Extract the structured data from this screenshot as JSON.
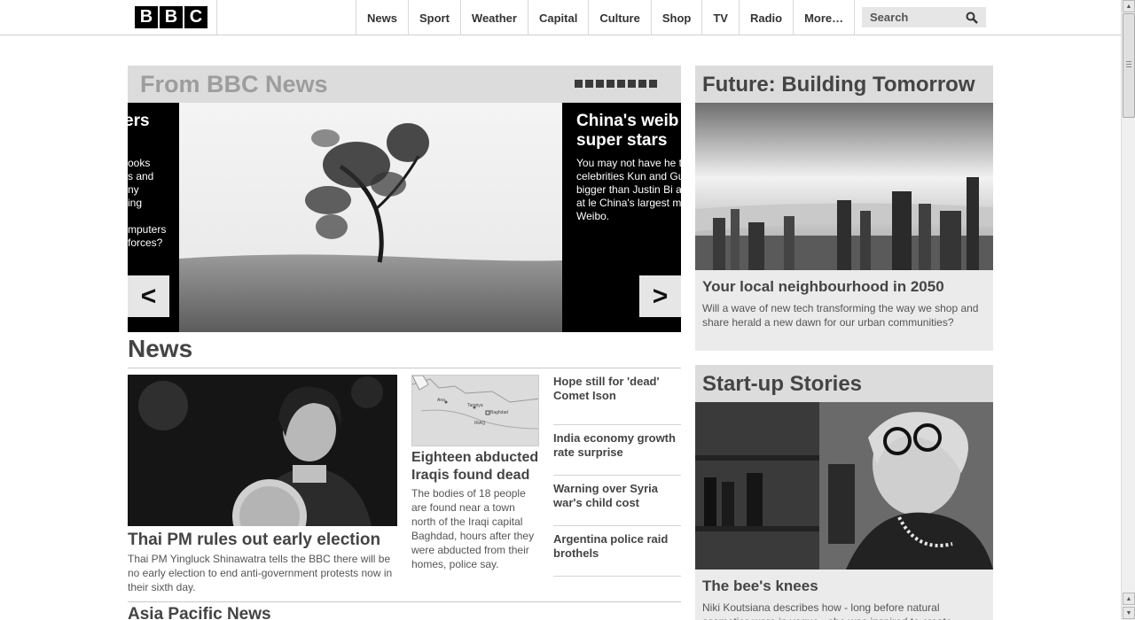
{
  "logo": {
    "letters": [
      "B",
      "B",
      "C"
    ]
  },
  "nav": {
    "items": [
      "News",
      "Sport",
      "Weather",
      "Capital",
      "Culture",
      "Shop",
      "TV",
      "Radio",
      "More…"
    ]
  },
  "search": {
    "placeholder": "Search",
    "icon": "magnifier-icon"
  },
  "carousel": {
    "title": "From BBC News",
    "dot_count": 8,
    "left_slide": {
      "heading": "ers",
      "lines": [
        "ooks",
        "s and",
        "ny",
        "ing",
        "",
        "mputers",
        " forces?"
      ]
    },
    "right_slide": {
      "heading_line1": "China's weib",
      "heading_line2": "super stars",
      "summary": "You may not have he them, but celebrities Kun and Guo Degan bigger than Justin Bi and Katy Perry, at le China's largest micro Sina Weibo."
    },
    "prev_label": "<",
    "next_label": ">"
  },
  "news": {
    "title": "News",
    "lead": {
      "headline": "Thai PM rules out early election",
      "summary": "Thai PM Yingluck Shinawatra tells the BBC there will be no early election to end anti-government protests now in their sixth day."
    },
    "secondary": {
      "headline": "Eighteen abducted Iraqis found dead",
      "summary": "The bodies of 18 people are found near a town north of the Iraqi capital Baghdad, hours after they were abducted from their homes, police say.",
      "map_labels": [
        "Ana",
        "Tarmiya",
        "Baghdad",
        "IRAQ"
      ]
    },
    "headlines": [
      {
        "line1": "Hope still for 'dead'",
        "line2": "Comet Ison"
      },
      {
        "line1": "India economy growth",
        "line2": "rate surprise"
      },
      {
        "line1": "Warning over Syria",
        "line2": "war's child cost"
      },
      {
        "line1": "Argentina police raid",
        "line2": "brothels"
      }
    ],
    "next_section_title": "Asia Pacific News"
  },
  "future": {
    "title": "Future: Building Tomorrow",
    "headline": "Your local neighbourhood in 2050",
    "summary": "Will a wave of new tech transforming the way we shop and share herald a new dawn for our urban communities?"
  },
  "startup": {
    "title": "Start-up Stories",
    "headline": "The bee's knees",
    "summary": "Niki Koutsiana describes how - long before natural cosmetics were in vogue - she was inspired to create"
  }
}
